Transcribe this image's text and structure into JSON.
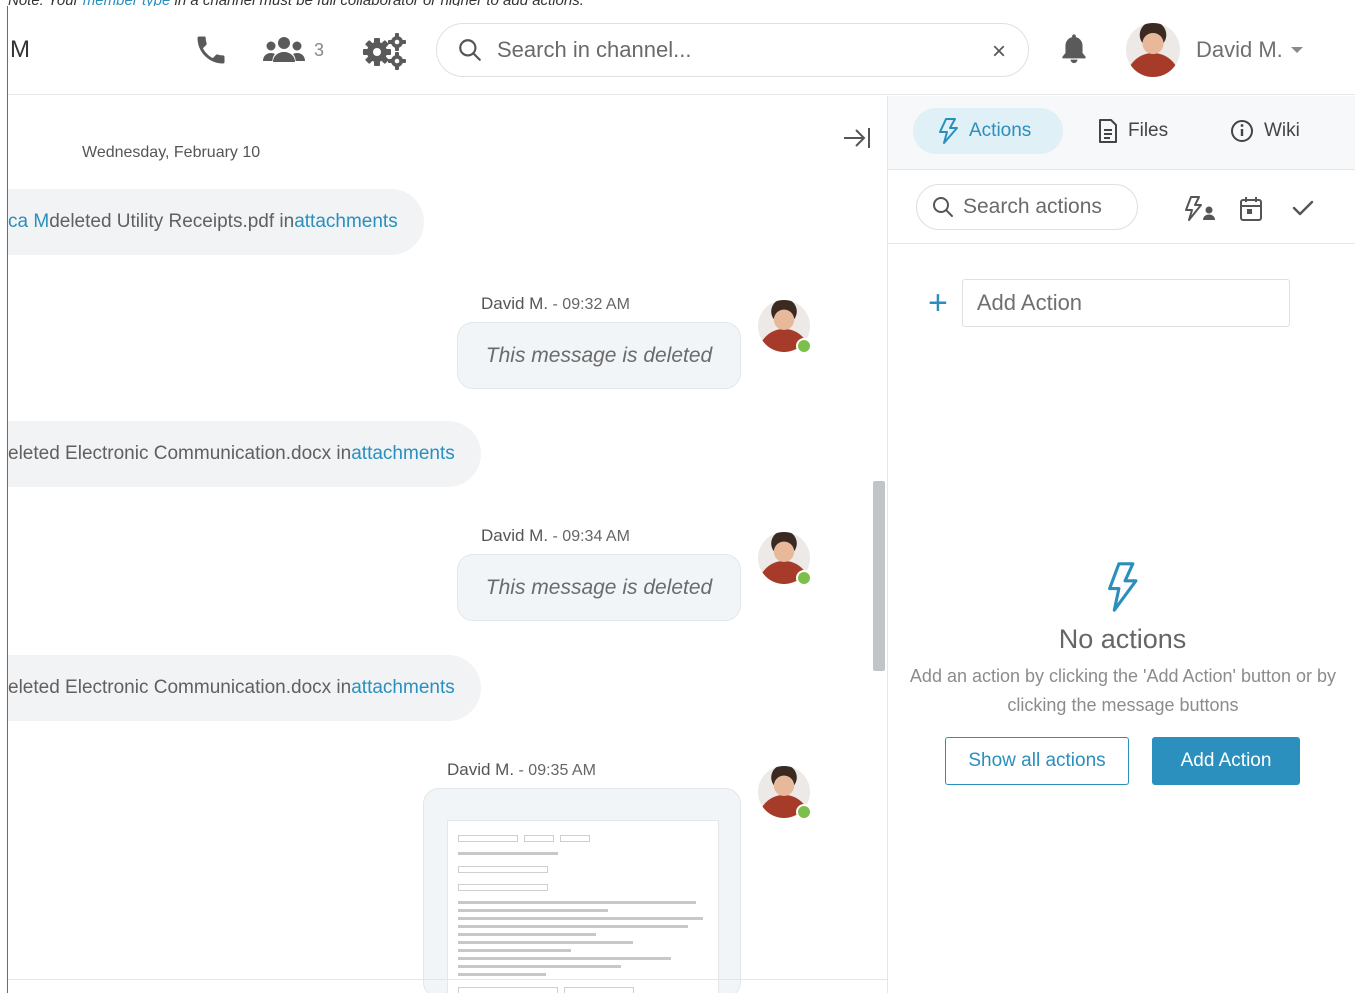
{
  "note": {
    "prefix": "Note: Your ",
    "link": "member type",
    "suffix": " in a channel must be full collaborator or higher to add actions."
  },
  "header": {
    "channel_initial": "M",
    "member_count": "3",
    "search_placeholder": "Search in channel...",
    "clear_symbol": "×",
    "user_name": "David M."
  },
  "chat": {
    "date": "Wednesday, February 10",
    "system_messages": [
      {
        "actor": "ca M",
        "text": " deleted Utility Receipts.pdf in ",
        "link": "attachments"
      },
      {
        "actor": "",
        "text": "eleted Electronic Communication.docx in ",
        "link": "attachments"
      },
      {
        "actor": "",
        "text": "eleted Electronic Communication.docx in ",
        "link": "attachments"
      }
    ],
    "messages": [
      {
        "author": "David M.",
        "time": " - 09:32 AM",
        "text": "This message is deleted"
      },
      {
        "author": "David M.",
        "time": " - 09:34 AM",
        "text": "This message is deleted"
      },
      {
        "author": "David M.",
        "time": " - 09:35 AM",
        "text": ""
      }
    ]
  },
  "panel": {
    "tabs": [
      {
        "label": "Actions",
        "active": true
      },
      {
        "label": "Files",
        "active": false
      },
      {
        "label": "Wiki",
        "active": false
      }
    ],
    "search_placeholder": "Search actions",
    "add_placeholder": "Add Action",
    "empty_title": "No actions",
    "empty_desc": "Add an action by clicking the 'Add Action' button or by clicking the message buttons",
    "show_all_label": "Show all actions",
    "add_action_label": "Add Action"
  },
  "colors": {
    "accent": "#2a8fbd",
    "online": "#7cc04b",
    "bubble": "#f1f5f8"
  }
}
